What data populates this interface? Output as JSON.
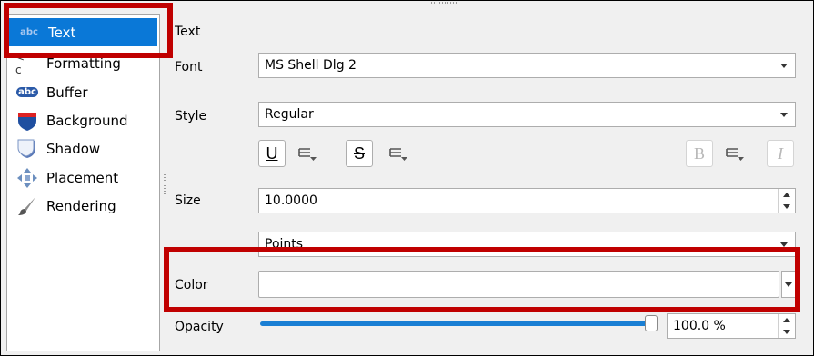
{
  "sidebar": {
    "items": [
      {
        "label": "Text",
        "icon": "text-abc-icon"
      },
      {
        "label": "Formatting",
        "icon": "formatting-icon",
        "icon_text": "< c"
      },
      {
        "label": "Buffer",
        "icon": "buffer-abc-icon",
        "icon_text": "abc"
      },
      {
        "label": "Background",
        "icon": "background-shield-icon"
      },
      {
        "label": "Shadow",
        "icon": "shadow-icon"
      },
      {
        "label": "Placement",
        "icon": "placement-arrows-icon"
      },
      {
        "label": "Rendering",
        "icon": "rendering-brush-icon"
      }
    ],
    "selected_icon_text": "abc"
  },
  "panel": {
    "section_title": "Text",
    "font": {
      "label": "Font",
      "value": "MS Shell Dlg 2"
    },
    "style": {
      "label": "Style",
      "value": "Regular"
    },
    "format_buttons": {
      "underline": "U",
      "strikeout": "S",
      "bold": "B",
      "italic": "I"
    },
    "size": {
      "label": "Size",
      "value": "10.0000"
    },
    "unit": {
      "value": "Points"
    },
    "color": {
      "label": "Color"
    },
    "opacity": {
      "label": "Opacity",
      "value": "100.0 %",
      "level": 1.0
    }
  },
  "colors": {
    "selection": "#0a78d7",
    "highlight": "#c00000",
    "slider": "#1a7fd4"
  }
}
